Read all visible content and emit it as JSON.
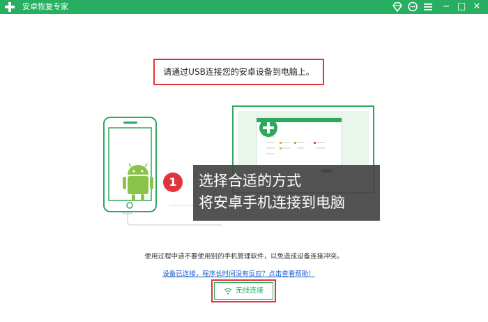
{
  "window": {
    "title": "安卓恢复专家",
    "controls": {
      "minimize": "−",
      "maximize": "□",
      "close": "✕"
    },
    "icons": [
      "app-logo-cross",
      "diamond-icon",
      "chat-icon",
      "menu-icon"
    ]
  },
  "prompt": {
    "text": "请通过USB连接您的安卓设备到电脑上。"
  },
  "overlay": {
    "step_number": "1",
    "line1": "选择合适的方式",
    "line2": "将安卓手机连接到电脑"
  },
  "note": "使用过程中请不要使用别的手机管理软件，以免造成设备连接冲突。",
  "help_link": "设备已连接，程序长时间没有反应？点击查看帮助！",
  "wireless_button": {
    "label": "无线连接",
    "icon": "wifi-icon"
  },
  "colors": {
    "brand_green": "#27ae60",
    "highlight_red": "#e0343a",
    "link_blue": "#1a5fd0"
  }
}
